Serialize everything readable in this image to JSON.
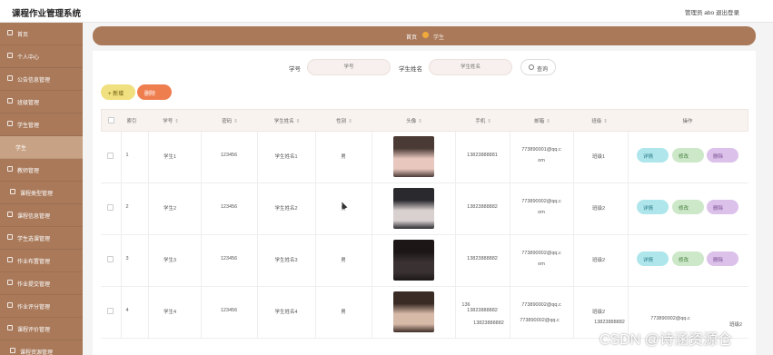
{
  "app": {
    "title": "课程作业管理系统",
    "admin_label": "管理员 abo",
    "logout_label": "退出登录"
  },
  "sidebar": {
    "items": [
      {
        "label": "首页"
      },
      {
        "label": "个人中心"
      },
      {
        "label": "公告信息管理"
      },
      {
        "label": "班级管理"
      },
      {
        "label": "学生管理"
      },
      {
        "label": "学生"
      },
      {
        "label": "教师管理"
      },
      {
        "label": "课程类型管理"
      },
      {
        "label": "课程信息管理"
      },
      {
        "label": "学生选课管理"
      },
      {
        "label": "作业布置管理"
      },
      {
        "label": "作业提交管理"
      },
      {
        "label": "作业评分管理"
      },
      {
        "label": "课程评价管理"
      },
      {
        "label": "课程资源管理"
      }
    ]
  },
  "breadcrumb": {
    "home": "首页",
    "current": "学生"
  },
  "search": {
    "field1_label": "学号",
    "field1_placeholder": "学号",
    "field2_label": "学生姓名",
    "field2_placeholder": "学生姓名",
    "button_label": "查询"
  },
  "toolbar": {
    "add_label": "+ 新增",
    "delete_label": "删除"
  },
  "table": {
    "headers": [
      "索引",
      "学号",
      "密码",
      "学生姓名",
      "性别",
      "头像",
      "手机",
      "邮箱",
      "班级",
      "操作"
    ],
    "rows": [
      {
        "index": "1",
        "student_no": "学生1",
        "password": "123456",
        "name": "学生姓名1",
        "gender": "男",
        "phone": "13823888881",
        "email1": "773890001@qq.c",
        "email2": "om",
        "class": "班级1"
      },
      {
        "index": "2",
        "student_no": "学生2",
        "password": "123456",
        "name": "学生姓名2",
        "gender": "男",
        "phone": "13823888882",
        "email1": "773890002@qq.c",
        "email2": "om",
        "class": "班级2"
      },
      {
        "index": "3",
        "student_no": "学生3",
        "password": "123456",
        "name": "学生姓名3",
        "gender": "男",
        "phone": "13823888882",
        "email1": "773890002@qq.c",
        "email2": "om",
        "class": "班级2"
      },
      {
        "index": "4",
        "student_no": "学生4",
        "password": "123456",
        "name": "学生姓名4",
        "gender": "男",
        "phone": "13823888882",
        "email1": "773890002@qq.c",
        "email2": "",
        "class": "班级2"
      }
    ],
    "row_actions": {
      "detail": "详情",
      "edit": "修改",
      "delete": "删除"
    },
    "overlap_artifacts": {
      "phone": "13823888882",
      "email": "773890002@qq.c",
      "class": "班级2",
      "small": "136"
    }
  },
  "watermark": "CSDN @诗涵资源仓"
}
